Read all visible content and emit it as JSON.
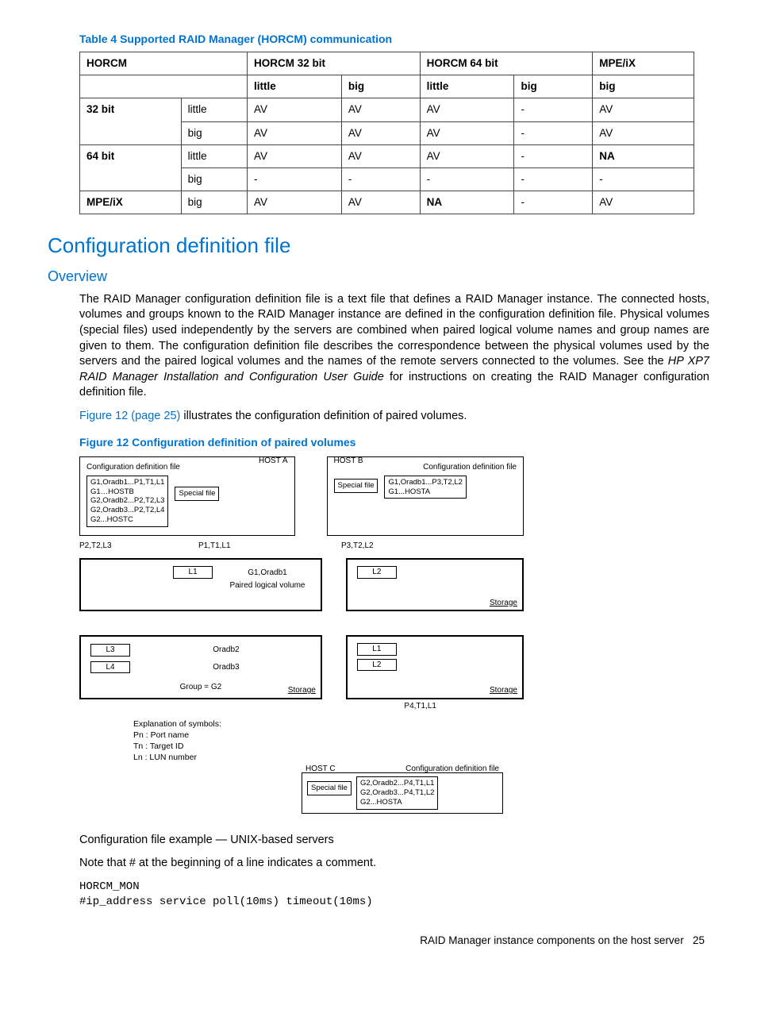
{
  "table": {
    "caption": "Table 4 Supported RAID Manager (HORCM) communication",
    "head_top": [
      "HORCM",
      "HORCM 32 bit",
      "HORCM 64 bit",
      "MPE/iX"
    ],
    "head_sub": [
      "little",
      "big",
      "little",
      "big",
      "big"
    ],
    "rows": [
      {
        "g": "32 bit",
        "s": "little",
        "c": [
          "AV",
          "AV",
          "AV",
          "-",
          "AV"
        ]
      },
      {
        "g": "",
        "s": "big",
        "c": [
          "AV",
          "AV",
          "AV",
          "-",
          "AV"
        ]
      },
      {
        "g": "64 bit",
        "s": "little",
        "c": [
          "AV",
          "AV",
          "AV",
          "-",
          "NA"
        ],
        "bold_last": true
      },
      {
        "g": "",
        "s": "big",
        "c": [
          "-",
          "-",
          "-",
          "-",
          "-"
        ]
      },
      {
        "g": "MPE/iX",
        "s": "big",
        "c": [
          "AV",
          "AV",
          "NA",
          "-",
          "AV"
        ],
        "bold_g": true,
        "bold_c2": true
      }
    ]
  },
  "section_title": "Configuration definition file",
  "subsection_title": "Overview",
  "para1a": "The RAID Manager configuration definition file is a text file that defines a RAID Manager instance. The connected hosts, volumes and groups known to the RAID Manager instance are defined in the configuration definition file. Physical volumes (special files) used independently by the servers are combined when paired logical volume names and group names are given to them. The configuration definition file describes the correspondence between the physical volumes used by the servers and the paired logical volumes and the names of the remote servers connected to the volumes. See the ",
  "para1i": "HP XP7 RAID Manager Installation and Configuration User Guide",
  "para1b": " for instructions on creating the RAID Manager configuration definition file.",
  "para2link": "Figure 12 (page 25)",
  "para2rest": " illustrates the configuration definition of paired volumes.",
  "figure_caption": "Figure 12 Configuration definition of paired volumes",
  "fig": {
    "hostA": {
      "label": "HOST A",
      "cfg_title": "Configuration definition file",
      "cfg_lines": "G1,Oradb1...P1,T1,L1\nG1…HOSTB\nG2,Oradb2...P2,T2,L3\nG2,Oradb3...P2,T2,L4\nG2...HOSTC",
      "special": "Special file"
    },
    "hostB": {
      "label": "HOST B",
      "cfg_title": "Configuration definition file",
      "cfg_lines": "G1,Oradb1...P3,T2,L2\nG1...HOSTA",
      "special": "Special file"
    },
    "ports": {
      "p2": "P2,T2,L3",
      "p1": "P1,T1,L1",
      "p3": "P3,T2,L2",
      "p4": "P4,T1,L1"
    },
    "mid": {
      "g1": "G1,Oradb1",
      "plv": "Paired logical volume",
      "l1": "L1",
      "l2": "L2",
      "storage": "Storage"
    },
    "low": {
      "l3": "L3",
      "l4": "L4",
      "o2": "Oradb2",
      "o3": "Oradb3",
      "grp": "Group = G2",
      "l1": "L1",
      "l2": "L2",
      "storage": "Storage"
    },
    "symbols": {
      "title": "Explanation of symbols:",
      "pn": "Pn  : Port name",
      "tn": "Tn  : Target ID",
      "ln": "Ln  : LUN number"
    },
    "hostC": {
      "label": "HOST C",
      "cfg_title": "Configuration definition file",
      "special": "Special file",
      "cfg_lines": "G2,Oradb2...P4,T1,L1\nG2,Oradb3...P4,T1,L2\nG2...HOSTA"
    }
  },
  "example_heading": "Configuration file example — UNIX-based servers",
  "example_note": "Note that # at the beginning of a line indicates a comment.",
  "code": "HORCM_MON\n#ip_address service poll(10ms) timeout(10ms)",
  "footer_text": "RAID Manager instance components on the host server",
  "footer_page": "25"
}
